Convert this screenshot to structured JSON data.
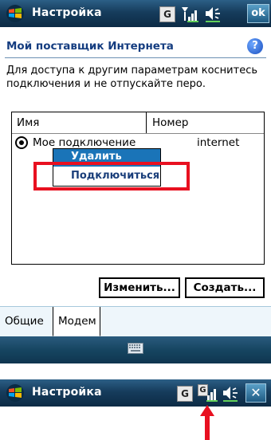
{
  "top_window": {
    "title": "Настройка",
    "g_label": "G",
    "ok_label": "ok"
  },
  "subheader": {
    "title": "Мой поставщик Интернета",
    "help_label": "?"
  },
  "description": "Для доступа к другим параметрам коснитесь подключения и не отпускайте перо.",
  "table": {
    "headers": [
      "Имя",
      "Номер"
    ],
    "rows": [
      {
        "name": "Мое подключение",
        "number": "internet"
      }
    ]
  },
  "context_menu": {
    "items": [
      "Удалить",
      "Подключиться"
    ]
  },
  "buttons": {
    "edit": "Изменить...",
    "create": "Создать..."
  },
  "tabs": [
    "Общие",
    "Модем"
  ],
  "bottom_window": {
    "title": "Настройка",
    "g_label": "G",
    "g_small_label": "G",
    "close_label": "✕"
  },
  "colors": {
    "title_bar": "#163c5c",
    "subtitle_text": "#153d80",
    "highlight_box": "#e81020",
    "menu_selected": "#1a74b8",
    "arrow": "#e81020"
  },
  "icons": [
    "windows-logo-icon",
    "signal-icon",
    "speaker-icon",
    "help-icon",
    "keyboard-icon",
    "close-icon",
    "arrow-up-icon"
  ]
}
